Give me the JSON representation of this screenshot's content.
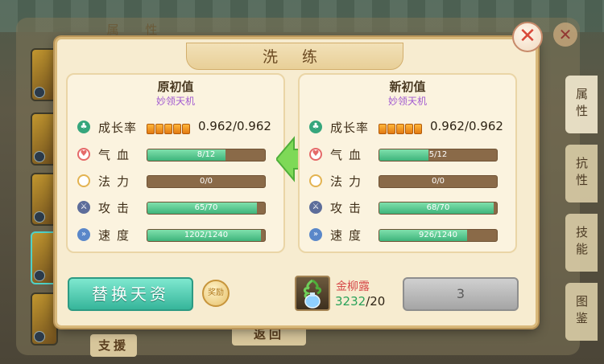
{
  "background": {
    "panel_title": "属 性",
    "side_tabs": [
      {
        "label": "属性",
        "active": true
      },
      {
        "label": "抗性",
        "active": false
      },
      {
        "label": "技能",
        "active": false
      },
      {
        "label": "图鉴",
        "active": false
      }
    ],
    "support_button": "支援",
    "back_button": "返回",
    "close_glyph": "✕"
  },
  "dialog": {
    "title": "洗 练",
    "close_glyph": "✕",
    "original": {
      "title": "原初值",
      "name": "妙领天机",
      "growth": {
        "label": "成长率",
        "pips": 5,
        "value": "0.962/0.962"
      },
      "stats": [
        {
          "key": "hp",
          "label": "气血",
          "text": "8/12",
          "fraction": 0.667
        },
        {
          "key": "mp",
          "label": "法力",
          "text": "0/0",
          "fraction": 0
        },
        {
          "key": "atk",
          "label": "攻击",
          "text": "65/70",
          "fraction": 0.929
        },
        {
          "key": "spd",
          "label": "速度",
          "text": "1202/1240",
          "fraction": 0.969
        }
      ]
    },
    "new": {
      "title": "新初值",
      "name": "妙领天机",
      "growth": {
        "label": "成长率",
        "pips": 5,
        "value": "0.962/0.962"
      },
      "stats": [
        {
          "key": "hp",
          "label": "气血",
          "text": "5/12",
          "fraction": 0.417
        },
        {
          "key": "mp",
          "label": "法力",
          "text": "0/0",
          "fraction": 0
        },
        {
          "key": "atk",
          "label": "攻击",
          "text": "68/70",
          "fraction": 0.971
        },
        {
          "key": "spd",
          "label": "速度",
          "text": "926/1240",
          "fraction": 0.747
        }
      ]
    },
    "replace_button": "替换天资",
    "coin_label": "奖励",
    "item": {
      "name": "金柳露",
      "have": "3232",
      "need": "/20"
    },
    "wash_button": "3"
  },
  "colors": {
    "accent": "#36b59a",
    "item_name": "#d64a4a",
    "count_have": "#2aa25a",
    "subtitle": "#a25bd0"
  }
}
